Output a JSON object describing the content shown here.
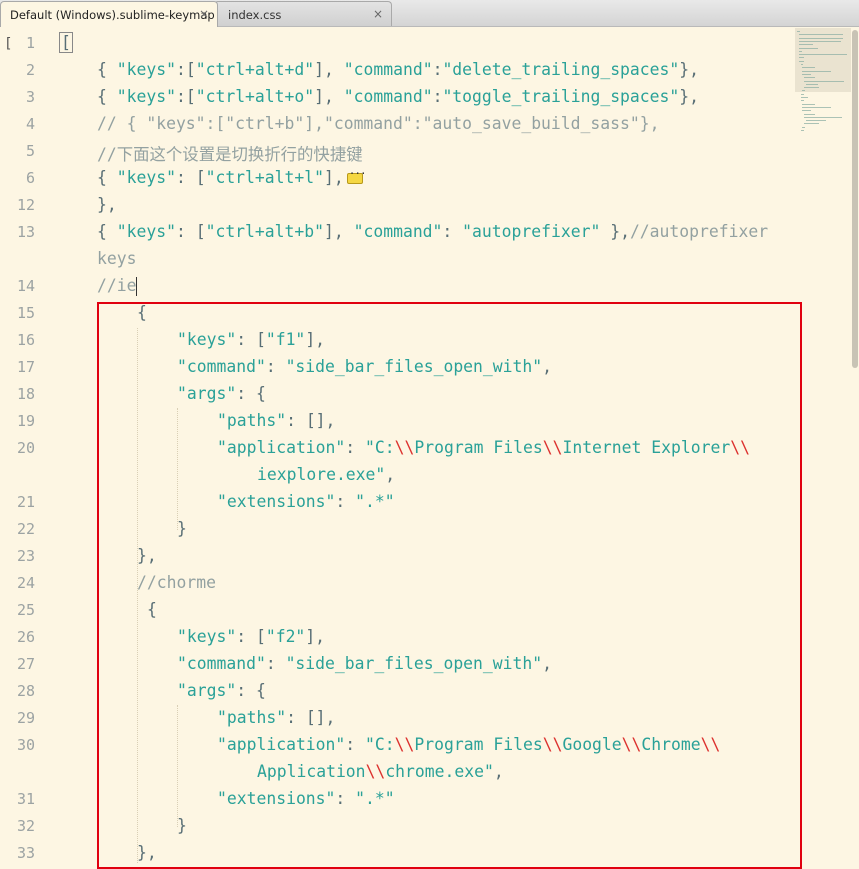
{
  "tabs": [
    {
      "label": "Default (Windows).sublime-keymap",
      "close": "×"
    },
    {
      "label": "index.css",
      "close": "×"
    }
  ],
  "gutter": {
    "fold_marker": "["
  },
  "lines": [
    {
      "num": "1",
      "segments": [
        {
          "t": "[",
          "c": "pn",
          "id": "bracket-first"
        }
      ]
    },
    {
      "num": "2",
      "segments": [
        {
          "t": "{ ",
          "c": "pn"
        },
        {
          "t": "\"keys\"",
          "c": "key"
        },
        {
          "t": ":[",
          "c": "pn"
        },
        {
          "t": "\"ctrl+alt+d\"",
          "c": "str"
        },
        {
          "t": "], ",
          "c": "pn"
        },
        {
          "t": "\"command\"",
          "c": "key"
        },
        {
          "t": ":",
          "c": "pn"
        },
        {
          "t": "\"delete_trailing_spaces\"",
          "c": "str"
        },
        {
          "t": "},",
          "c": "pn"
        }
      ]
    },
    {
      "num": "3",
      "segments": [
        {
          "t": "{ ",
          "c": "pn"
        },
        {
          "t": "\"keys\"",
          "c": "key"
        },
        {
          "t": ":[",
          "c": "pn"
        },
        {
          "t": "\"ctrl+alt+o\"",
          "c": "str"
        },
        {
          "t": "], ",
          "c": "pn"
        },
        {
          "t": "\"command\"",
          "c": "key"
        },
        {
          "t": ":",
          "c": "pn"
        },
        {
          "t": "\"toggle_trailing_spaces\"",
          "c": "str"
        },
        {
          "t": "},",
          "c": "pn"
        }
      ]
    },
    {
      "num": "4",
      "segments": [
        {
          "t": "// { \"keys\":[\"ctrl+b\"],\"command\":\"auto_save_build_sass\"},",
          "c": "cm"
        }
      ]
    },
    {
      "num": "5",
      "segments": [
        {
          "t": "//下面这个设置是切换折行的快捷键",
          "c": "cm"
        }
      ]
    },
    {
      "num": "6",
      "segments": [
        {
          "t": "{ ",
          "c": "pn"
        },
        {
          "t": "\"keys\"",
          "c": "key"
        },
        {
          "t": ": [",
          "c": "pn"
        },
        {
          "t": "\"ctrl+alt+l\"",
          "c": "str"
        },
        {
          "t": "],",
          "c": "pn"
        },
        {
          "t": "",
          "c": "fold"
        }
      ]
    },
    {
      "num": "12",
      "segments": [
        {
          "t": "},",
          "c": "pn"
        }
      ]
    },
    {
      "num": "13",
      "segments": [
        {
          "t": "{ ",
          "c": "pn"
        },
        {
          "t": "\"keys\"",
          "c": "key"
        },
        {
          "t": ": [",
          "c": "pn"
        },
        {
          "t": "\"ctrl+alt+b\"",
          "c": "str"
        },
        {
          "t": "], ",
          "c": "pn"
        },
        {
          "t": "\"command\"",
          "c": "key"
        },
        {
          "t": ": ",
          "c": "pn"
        },
        {
          "t": "\"autoprefixer\"",
          "c": "str"
        },
        {
          "t": " },",
          "c": "pn"
        },
        {
          "t": "//autoprefixer",
          "c": "cm"
        }
      ]
    },
    {
      "num": "",
      "segments": [
        {
          "t": "keys",
          "c": "cm"
        }
      ]
    },
    {
      "num": "14",
      "segments": [
        {
          "t": "//ie",
          "c": "cm"
        },
        {
          "t": "",
          "c": "cursor"
        }
      ]
    },
    {
      "num": "15",
      "segments": [
        {
          "t": "{",
          "c": "pn"
        }
      ]
    },
    {
      "num": "16",
      "segments": [
        {
          "t": "\"keys\"",
          "c": "key"
        },
        {
          "t": ": [",
          "c": "pn"
        },
        {
          "t": "\"f1\"",
          "c": "str"
        },
        {
          "t": "],",
          "c": "pn"
        }
      ]
    },
    {
      "num": "17",
      "segments": [
        {
          "t": "\"command\"",
          "c": "key"
        },
        {
          "t": ": ",
          "c": "pn"
        },
        {
          "t": "\"side_bar_files_open_with\"",
          "c": "str"
        },
        {
          "t": ",",
          "c": "pn"
        }
      ]
    },
    {
      "num": "18",
      "segments": [
        {
          "t": "\"args\"",
          "c": "key"
        },
        {
          "t": ": {",
          "c": "pn"
        }
      ]
    },
    {
      "num": "19",
      "segments": [
        {
          "t": "\"paths\"",
          "c": "key"
        },
        {
          "t": ": [],",
          "c": "pn"
        }
      ]
    },
    {
      "num": "20",
      "segments": [
        {
          "t": "\"application\"",
          "c": "key"
        },
        {
          "t": ": ",
          "c": "pn"
        },
        {
          "t": "\"C:",
          "c": "str"
        },
        {
          "t": "\\\\",
          "c": "esc"
        },
        {
          "t": "Program Files",
          "c": "str"
        },
        {
          "t": "\\\\",
          "c": "esc"
        },
        {
          "t": "Internet Explorer",
          "c": "str"
        },
        {
          "t": "\\\\",
          "c": "esc"
        }
      ]
    },
    {
      "num": "",
      "segments": [
        {
          "t": "iexplore.exe\"",
          "c": "str"
        },
        {
          "t": ",",
          "c": "pn"
        }
      ]
    },
    {
      "num": "21",
      "segments": [
        {
          "t": "\"extensions\"",
          "c": "key"
        },
        {
          "t": ": ",
          "c": "pn"
        },
        {
          "t": "\".*\"",
          "c": "str"
        }
      ]
    },
    {
      "num": "22",
      "segments": [
        {
          "t": "}",
          "c": "pn"
        }
      ]
    },
    {
      "num": "23",
      "segments": [
        {
          "t": "},",
          "c": "pn"
        }
      ]
    },
    {
      "num": "24",
      "segments": [
        {
          "t": "//chorme",
          "c": "cm"
        }
      ]
    },
    {
      "num": "25",
      "segments": [
        {
          "t": "{",
          "c": "pn"
        }
      ]
    },
    {
      "num": "26",
      "segments": [
        {
          "t": "\"keys\"",
          "c": "key"
        },
        {
          "t": ": [",
          "c": "pn"
        },
        {
          "t": "\"f2\"",
          "c": "str"
        },
        {
          "t": "],",
          "c": "pn"
        }
      ]
    },
    {
      "num": "27",
      "segments": [
        {
          "t": "\"command\"",
          "c": "key"
        },
        {
          "t": ": ",
          "c": "pn"
        },
        {
          "t": "\"side_bar_files_open_with\"",
          "c": "str"
        },
        {
          "t": ",",
          "c": "pn"
        }
      ]
    },
    {
      "num": "28",
      "segments": [
        {
          "t": "\"args\"",
          "c": "key"
        },
        {
          "t": ": {",
          "c": "pn"
        }
      ]
    },
    {
      "num": "29",
      "segments": [
        {
          "t": "\"paths\"",
          "c": "key"
        },
        {
          "t": ": [],",
          "c": "pn"
        }
      ]
    },
    {
      "num": "30",
      "segments": [
        {
          "t": "\"application\"",
          "c": "key"
        },
        {
          "t": ": ",
          "c": "pn"
        },
        {
          "t": "\"C:",
          "c": "str"
        },
        {
          "t": "\\\\",
          "c": "esc"
        },
        {
          "t": "Program Files",
          "c": "str"
        },
        {
          "t": "\\\\",
          "c": "esc"
        },
        {
          "t": "Google",
          "c": "str"
        },
        {
          "t": "\\\\",
          "c": "esc"
        },
        {
          "t": "Chrome",
          "c": "str"
        },
        {
          "t": "\\\\",
          "c": "esc"
        }
      ]
    },
    {
      "num": "",
      "segments": [
        {
          "t": "Application",
          "c": "str"
        },
        {
          "t": "\\\\",
          "c": "esc"
        },
        {
          "t": "chrome.exe\"",
          "c": "str"
        },
        {
          "t": ",",
          "c": "pn"
        }
      ]
    },
    {
      "num": "31",
      "segments": [
        {
          "t": "\"extensions\"",
          "c": "key"
        },
        {
          "t": ": ",
          "c": "pn"
        },
        {
          "t": "\".*\"",
          "c": "str"
        }
      ]
    },
    {
      "num": "32",
      "segments": [
        {
          "t": "}",
          "c": "pn"
        }
      ]
    },
    {
      "num": "33",
      "segments": [
        {
          "t": "},",
          "c": "pn"
        }
      ]
    }
  ],
  "colors": {
    "background": "#fdf6e3",
    "string": "#2aa198",
    "comment": "#93a1a1",
    "escape": "#dc322f",
    "highlight_box": "#e0000f"
  }
}
